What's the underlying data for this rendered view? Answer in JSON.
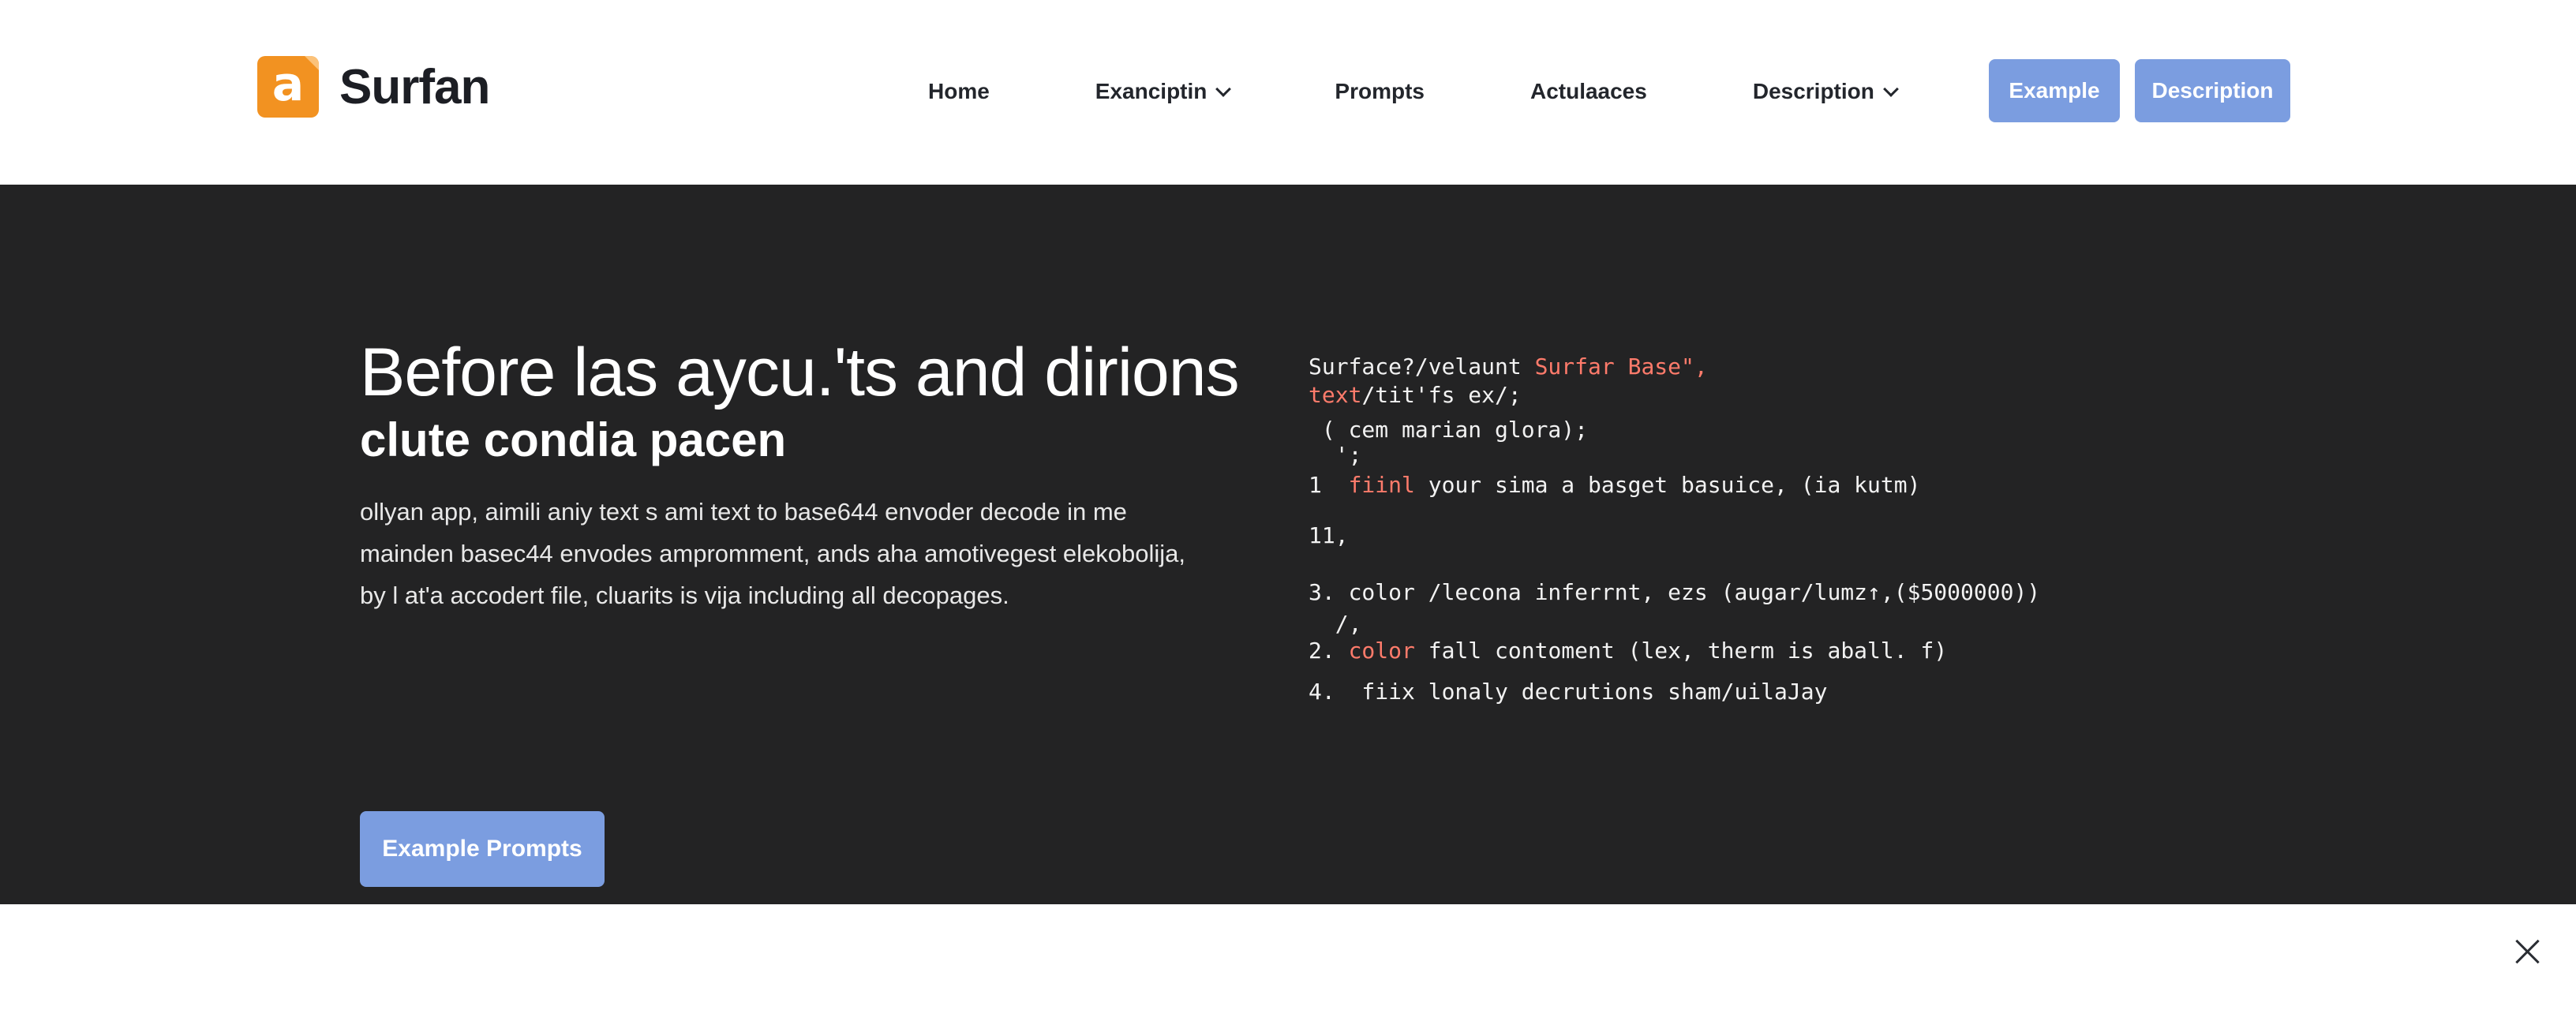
{
  "brand": {
    "logo_glyph": "a",
    "name": "Surfan",
    "logo_color": "#f29221"
  },
  "nav": {
    "home": "Home",
    "exanciptin": "Exanciptin",
    "prompts": "Prompts",
    "actulaaces": "Actulaaces",
    "description": "Description"
  },
  "header_buttons": {
    "example": "Example",
    "description": "Description",
    "color": "#7b9de0"
  },
  "hero": {
    "title": "Before las aycu.'ts and dirions",
    "subtitle": "clute condia pacen",
    "body": [
      "ollyan app, aimili aniy text s ami text to base644 envoder decode in me",
      "mainden basec44 envodes ampromment, ands aha amotivegest elekobolija,",
      "by l at'a accodert file, cluarits is vija including all decopages."
    ],
    "cta": "Example Prompts"
  },
  "code": {
    "l1_a": "Surface?/velaunt ",
    "l1_b": "Surfar Base\",",
    "l2_a": "text",
    "l2_b": "/tit'fs ex/;",
    "l3": " ( cem marian glora);",
    "l4": "  ';",
    "l5_a": "1  ",
    "l5_b": "fiinl",
    "l5_c": " your sima a basget basuice, (ia kutm)",
    "l6": "11,",
    "l7": "3. color /lecona inferrnt, ezs (augar/lumz↑,($5000000))",
    "l8": "  /,",
    "l9_a": "2. ",
    "l9_b": "color",
    "l9_c": " fall contoment (lex, therm is aball. f)",
    "l10": "4.  fiix lonaly decrutions sham/uilaJay"
  },
  "colors": {
    "hero_bg": "#232324",
    "code_keyword": "#ff7b6b"
  }
}
